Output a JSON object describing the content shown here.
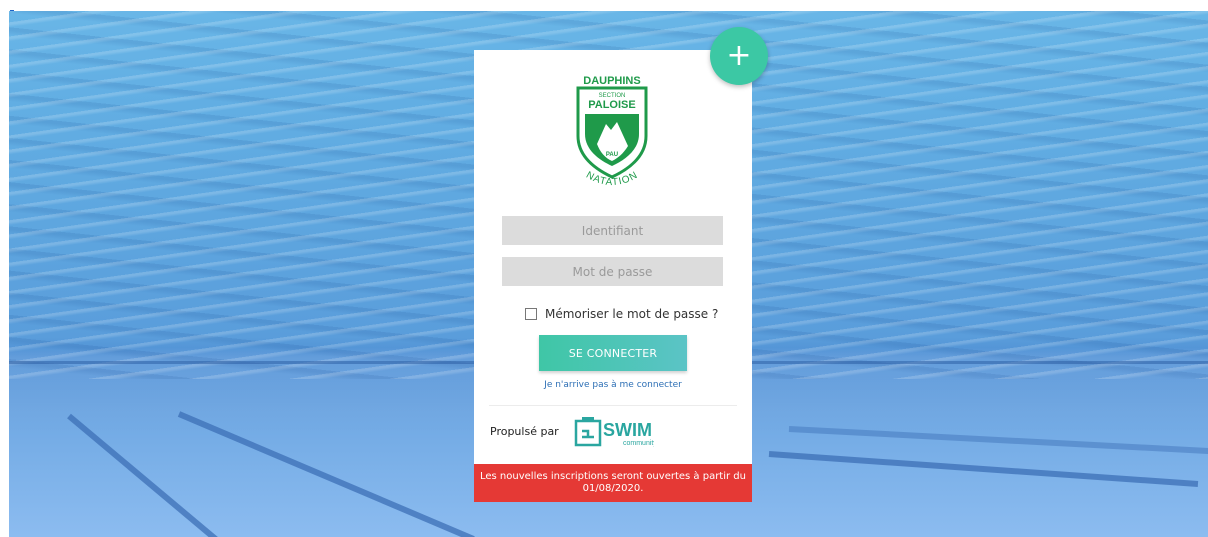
{
  "login": {
    "logo": {
      "line1": "DAUPHINS",
      "line2": "SECTION",
      "line3": "PALOISE",
      "city": "PAU",
      "arc": "NATATION"
    },
    "username_placeholder": "Identifiant",
    "password_placeholder": "Mot de passe",
    "remember_label": "Mémoriser le mot de passe ?",
    "submit_label": "SE CONNECTER",
    "forgot_link": "Je n'arrive pas à me connecter"
  },
  "footer": {
    "powered_by": "Propulsé par",
    "brand": "SWIM",
    "brand_sub": "community"
  },
  "notice": {
    "text": "Les nouvelles inscriptions seront ouvertes à partir du 01/08/2020."
  },
  "fab": {
    "symbol": "+"
  },
  "colors": {
    "accent": "#3cc8a4",
    "logo_green": "#1f9a4a",
    "notice_red": "#e53935",
    "link_blue": "#2d6fb5"
  }
}
